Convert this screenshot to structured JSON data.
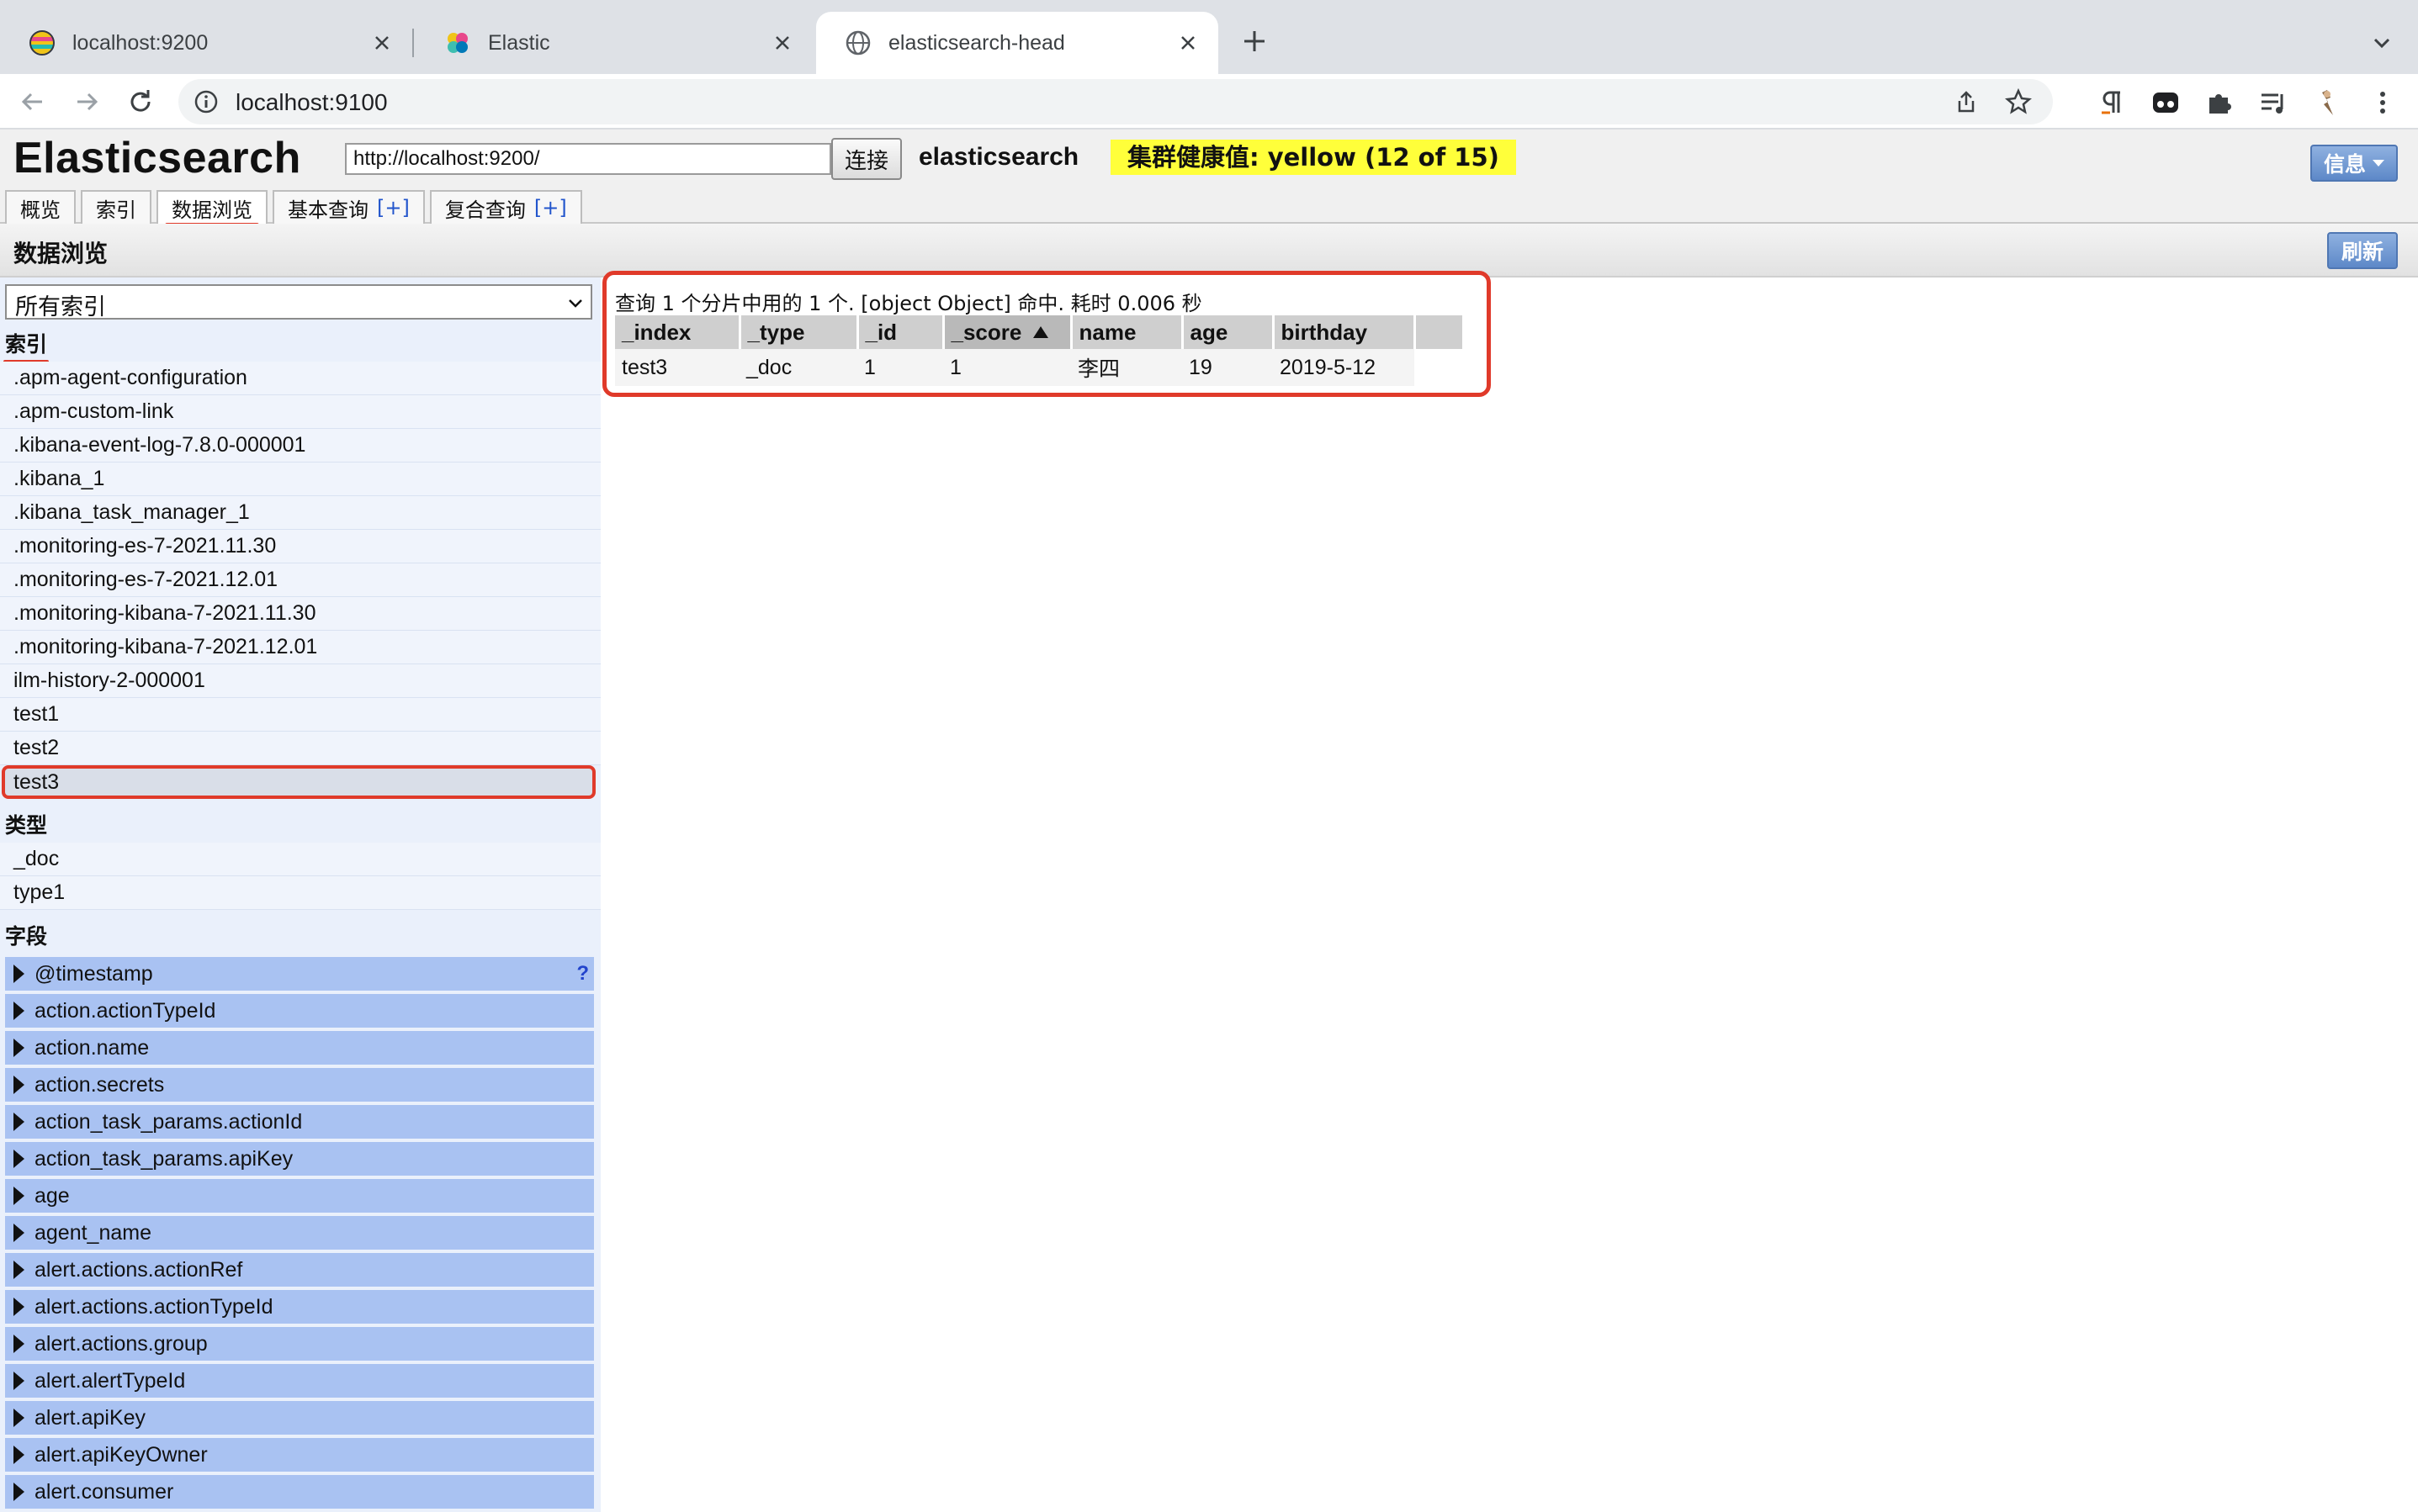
{
  "browser": {
    "tabs": [
      {
        "title": "localhost:9200",
        "icon": "elastic-logo-icon"
      },
      {
        "title": "Elastic",
        "icon": "elastic-flower-icon"
      },
      {
        "title": "elasticsearch-head",
        "icon": "globe-icon"
      }
    ],
    "active_tab": 2,
    "url": "localhost:9100"
  },
  "header": {
    "app_title": "Elasticsearch",
    "connect_url": "http://localhost:9200/",
    "connect_label": "连接",
    "cluster_name": "elasticsearch",
    "health_text": "集群健康值: yellow (12 of 15)",
    "health_color": "#ffff3a",
    "info_label": "信息"
  },
  "nav": {
    "tabs": [
      {
        "label": "概览",
        "plus": ""
      },
      {
        "label": "索引",
        "plus": ""
      },
      {
        "label": "数据浏览",
        "plus": ""
      },
      {
        "label": "基本查询",
        "plus": "[+]"
      },
      {
        "label": "复合查询",
        "plus": "[+]"
      }
    ],
    "active": 2
  },
  "section": {
    "title": "数据浏览",
    "refresh_label": "刷新"
  },
  "sidebar": {
    "index_select": "所有索引",
    "indices_heading": "索引",
    "indices": [
      ".apm-agent-configuration",
      ".apm-custom-link",
      ".kibana-event-log-7.8.0-000001",
      ".kibana_1",
      ".kibana_task_manager_1",
      ".monitoring-es-7-2021.11.30",
      ".monitoring-es-7-2021.12.01",
      ".monitoring-kibana-7-2021.11.30",
      ".monitoring-kibana-7-2021.12.01",
      "ilm-history-2-000001",
      "test1",
      "test2",
      "test3"
    ],
    "selected_index": 12,
    "types_heading": "类型",
    "types": [
      "_doc",
      "type1"
    ],
    "fields_heading": "字段",
    "fields": [
      "@timestamp",
      "action.actionTypeId",
      "action.name",
      "action.secrets",
      "action_task_params.actionId",
      "action_task_params.apiKey",
      "age",
      "agent_name",
      "alert.actions.actionRef",
      "alert.actions.actionTypeId",
      "alert.actions.group",
      "alert.alertTypeId",
      "alert.apiKey",
      "alert.apiKeyOwner",
      "alert.consumer"
    ],
    "help_mark": "?"
  },
  "results": {
    "summary": "查询 1 个分片中用的 1 个. [object Object] 命中. 耗时 0.006 秒",
    "columns": [
      "_index",
      "_type",
      "_id",
      "_score",
      "name",
      "age",
      "birthday"
    ],
    "sorted_column": 3,
    "rows": [
      [
        "test3",
        "_doc",
        "1",
        "1",
        "李四",
        "19",
        "2019-5-12"
      ]
    ]
  },
  "colors": {
    "accent_blue": "#5d88c8",
    "highlight_red": "#e03a2a",
    "field_bg": "#a9c2f2"
  }
}
